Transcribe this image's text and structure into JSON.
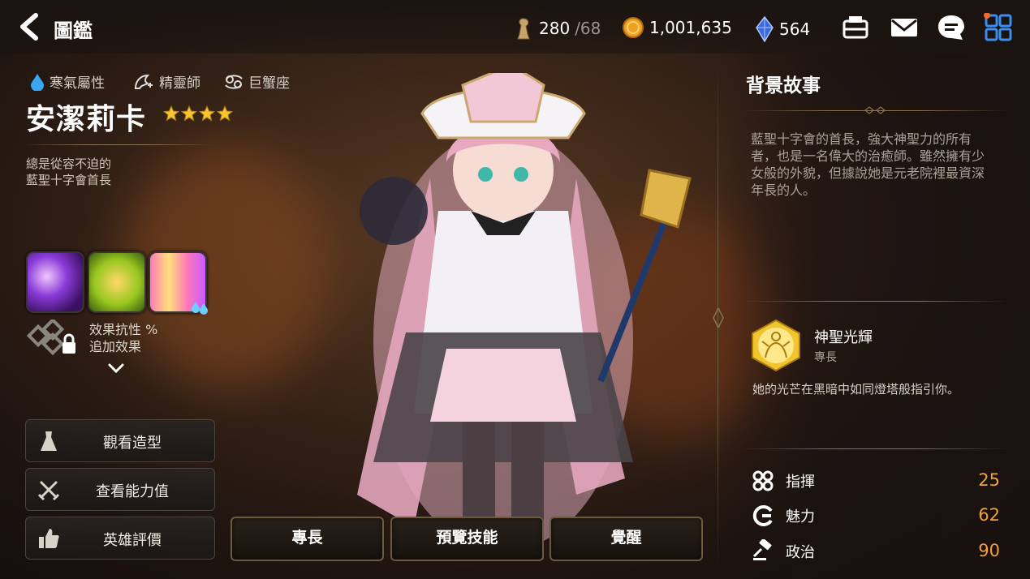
{
  "header": {
    "title": "圖鑑",
    "stamina_value": "280",
    "stamina_max": "/68",
    "gold": "1,001,635",
    "crystal": "564"
  },
  "hero": {
    "attributes": [
      {
        "icon": "water-drop-icon",
        "label": "寒氣屬性"
      },
      {
        "icon": "mage-class-icon",
        "label": "精靈師"
      },
      {
        "icon": "cancer-zodiac-icon",
        "label": "巨蟹座"
      }
    ],
    "name": "安潔莉卡",
    "star_count": 4,
    "tagline": "總是從容不迫的\n藍聖十字會首長",
    "effect_text": "效果抗性 %\n追加效果"
  },
  "side_buttons": {
    "costume": "觀看造型",
    "stats": "查看能力值",
    "review": "英雄評價"
  },
  "bottom_buttons": {
    "specialty": "專長",
    "preview_skills": "預覽技能",
    "awaken": "覺醒"
  },
  "story": {
    "title": "背景故事",
    "text": "藍聖十字會的首長，強大神聖力的所有者，也是一名偉大的治癒師。雖然擁有少女般的外貌，但據說她是元老院裡最資深年長的人。"
  },
  "specialty": {
    "name": "神聖光輝",
    "type": "專長",
    "description": "她的光芒在黑暗中如同燈塔般指引你。"
  },
  "stats": [
    {
      "icon": "command-icon",
      "label": "指揮",
      "value": "25"
    },
    {
      "icon": "charm-icon",
      "label": "魅力",
      "value": "62"
    },
    {
      "icon": "politics-gavel-icon",
      "label": "政治",
      "value": "90"
    }
  ],
  "colors": {
    "accent_gold": "#f0a238",
    "star": "#f7c531",
    "notification": "#f06a28",
    "menu_blue": "#3a8ef0"
  }
}
